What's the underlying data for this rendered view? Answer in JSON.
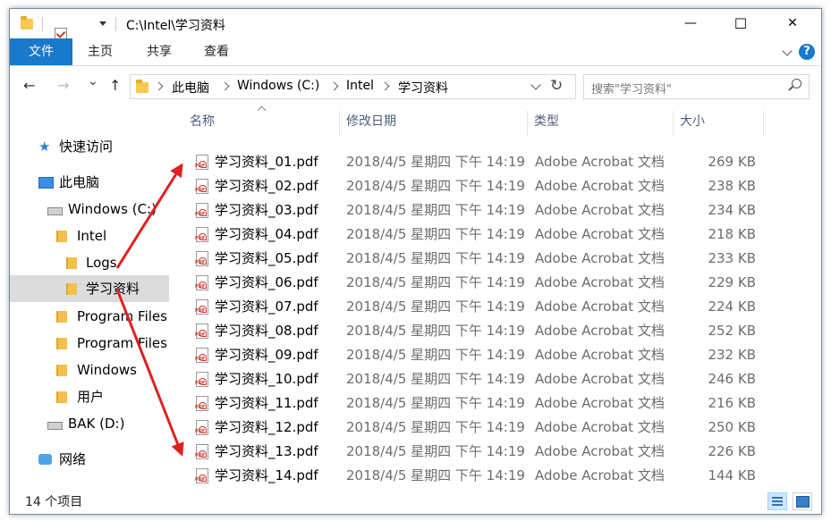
{
  "window": {
    "title": "C:\\Intel\\学习资料",
    "minimize": "—",
    "maximize": "☐",
    "close": "✕"
  },
  "ribbon": {
    "file": "文件",
    "home": "主页",
    "share": "共享",
    "view": "查看",
    "help": "?"
  },
  "nav": {
    "back": "←",
    "forward": "→",
    "recent": "⌄",
    "up": "↑",
    "breadcrumb": [
      "此电脑",
      "Windows (C:)",
      "Intel",
      "学习资料"
    ],
    "refresh": "↻",
    "search_placeholder": "搜索\"学习资料\""
  },
  "tree": {
    "quick_access": "快速访问",
    "this_pc": "此电脑",
    "c_drive": "Windows (C:)",
    "intel": "Intel",
    "logs": "Logs",
    "study": "学习资料",
    "program_files": "Program Files",
    "program_files_x86": "Program Files",
    "windows": "Windows",
    "users": "用户",
    "d_drive": "BAK (D:)",
    "network": "网络"
  },
  "columns": {
    "name": "名称",
    "date": "修改日期",
    "type": "类型",
    "size": "大小"
  },
  "files": [
    {
      "name": "学习资料_01.pdf",
      "date": "2018/4/5 星期四 下午 14:19",
      "type": "Adobe Acrobat 文档",
      "size": "269 KB"
    },
    {
      "name": "学习资料_02.pdf",
      "date": "2018/4/5 星期四 下午 14:19",
      "type": "Adobe Acrobat 文档",
      "size": "238 KB"
    },
    {
      "name": "学习资料_03.pdf",
      "date": "2018/4/5 星期四 下午 14:19",
      "type": "Adobe Acrobat 文档",
      "size": "234 KB"
    },
    {
      "name": "学习资料_04.pdf",
      "date": "2018/4/5 星期四 下午 14:19",
      "type": "Adobe Acrobat 文档",
      "size": "218 KB"
    },
    {
      "name": "学习资料_05.pdf",
      "date": "2018/4/5 星期四 下午 14:19",
      "type": "Adobe Acrobat 文档",
      "size": "233 KB"
    },
    {
      "name": "学习资料_06.pdf",
      "date": "2018/4/5 星期四 下午 14:19",
      "type": "Adobe Acrobat 文档",
      "size": "229 KB"
    },
    {
      "name": "学习资料_07.pdf",
      "date": "2018/4/5 星期四 下午 14:19",
      "type": "Adobe Acrobat 文档",
      "size": "224 KB"
    },
    {
      "name": "学习资料_08.pdf",
      "date": "2018/4/5 星期四 下午 14:19",
      "type": "Adobe Acrobat 文档",
      "size": "252 KB"
    },
    {
      "name": "学习资料_09.pdf",
      "date": "2018/4/5 星期四 下午 14:19",
      "type": "Adobe Acrobat 文档",
      "size": "232 KB"
    },
    {
      "name": "学习资料_10.pdf",
      "date": "2018/4/5 星期四 下午 14:19",
      "type": "Adobe Acrobat 文档",
      "size": "246 KB"
    },
    {
      "name": "学习资料_11.pdf",
      "date": "2018/4/5 星期四 下午 14:19",
      "type": "Adobe Acrobat 文档",
      "size": "216 KB"
    },
    {
      "name": "学习资料_12.pdf",
      "date": "2018/4/5 星期四 下午 14:19",
      "type": "Adobe Acrobat 文档",
      "size": "250 KB"
    },
    {
      "name": "学习资料_13.pdf",
      "date": "2018/4/5 星期四 下午 14:19",
      "type": "Adobe Acrobat 文档",
      "size": "226 KB"
    },
    {
      "name": "学习资料_14.pdf",
      "date": "2018/4/5 星期四 下午 14:19",
      "type": "Adobe Acrobat 文档",
      "size": "144 KB"
    }
  ],
  "status": {
    "count": "14 个项目"
  },
  "colors": {
    "accent": "#1979ca",
    "selected": "#dcdcdc",
    "arrow": "#e02020"
  }
}
